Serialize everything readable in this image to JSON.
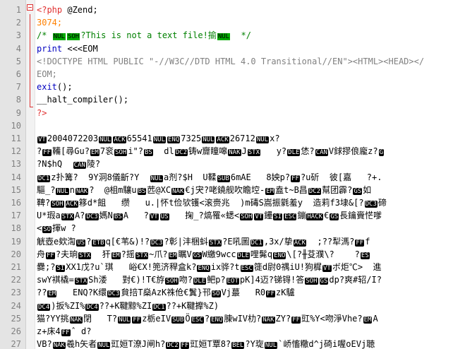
{
  "lines": [
    {
      "n": "1",
      "segs": [
        {
          "t": "<?php",
          "c": "php"
        },
        {
          "t": " @Zend;",
          "c": ""
        }
      ]
    },
    {
      "n": "2",
      "segs": [
        {
          "t": "3074;",
          "c": "num"
        }
      ]
    },
    {
      "n": "3",
      "segs": [
        {
          "t": "/* ",
          "c": "cmt"
        },
        {
          "t": "NUL",
          "c": "cg"
        },
        {
          "t": "SOH",
          "c": "cg"
        },
        {
          "t": "?This is not a text file!揄",
          "c": "cmt"
        },
        {
          "t": "NUL",
          "c": "cg"
        },
        {
          "t": "  */",
          "c": "cmt"
        }
      ]
    },
    {
      "n": "4",
      "segs": [
        {
          "t": "print",
          "c": "kw"
        },
        {
          "t": " <<<EOM",
          "c": ""
        }
      ]
    },
    {
      "n": "5",
      "segs": [
        {
          "t": "<!DOCTYPE HTML PUBLIC \"-//W3C//DTD HTML 4.0 Transitional//EN\"><HTML><HEAD></",
          "c": "hd"
        }
      ]
    },
    {
      "n": "6",
      "segs": [
        {
          "t": "EOM;",
          "c": "hd"
        }
      ]
    },
    {
      "n": "7",
      "segs": [
        {
          "t": "exit",
          "c": "kw"
        },
        {
          "t": "();",
          "c": ""
        }
      ]
    },
    {
      "n": "8",
      "segs": [
        {
          "t": "__halt_compiler",
          "c": ""
        },
        {
          "t": "();",
          "c": ""
        }
      ]
    },
    {
      "n": "9",
      "segs": [
        {
          "t": "?>",
          "c": "php"
        }
      ]
    },
    {
      "n": "10",
      "segs": []
    },
    {
      "n": "11",
      "segs": [
        {
          "t": "VT",
          "c": "cc"
        },
        {
          "t": "2004072203",
          "c": ""
        },
        {
          "t": "NUL",
          "c": "cc"
        },
        {
          "t": "ACK",
          "c": "cc"
        },
        {
          "t": "65541",
          "c": ""
        },
        {
          "t": "NUL",
          "c": "cc"
        },
        {
          "t": "ENQ",
          "c": "cc"
        },
        {
          "t": "7325",
          "c": ""
        },
        {
          "t": "NUL",
          "c": "cc"
        },
        {
          "t": "ACK",
          "c": "cc"
        },
        {
          "t": "26712",
          "c": ""
        },
        {
          "t": "NUL",
          "c": "cc"
        },
        {
          "t": "x?",
          "c": ""
        }
      ]
    },
    {
      "n": "12",
      "segs": [
        {
          "t": "?",
          "c": ""
        },
        {
          "t": "FF",
          "c": "cc"
        },
        {
          "t": "鞴[尋Gu?",
          "c": ""
        },
        {
          "t": "EM",
          "c": "cc"
        },
        {
          "t": "7衮",
          "c": ""
        },
        {
          "t": "SOH",
          "c": "cc"
        },
        {
          "t": "i\"?",
          "c": ""
        },
        {
          "t": "BS",
          "c": "cc"
        },
        {
          "t": "  dl",
          "c": ""
        },
        {
          "t": "DC2",
          "c": "cc"
        },
        {
          "t": "铸w齎瞳嗥",
          "c": ""
        },
        {
          "t": "NAK",
          "c": "cc"
        },
        {
          "t": "J",
          "c": ""
        },
        {
          "t": "STX",
          "c": "cc"
        },
        {
          "t": "   y?",
          "c": ""
        },
        {
          "t": "DLE",
          "c": "cc"
        },
        {
          "t": "恷?",
          "c": ""
        },
        {
          "t": "CAN",
          "c": "cc"
        },
        {
          "t": "V銶摎俍龐z?",
          "c": ""
        },
        {
          "t": "G",
          "c": "cc"
        }
      ]
    },
    {
      "n": "13",
      "segs": [
        {
          "t": "?N$hQ  ",
          "c": ""
        },
        {
          "t": "CAN",
          "c": "cc"
        },
        {
          "t": "陵?",
          "c": ""
        }
      ]
    },
    {
      "n": "14",
      "segs": [
        {
          "t": "DC1",
          "c": "cc"
        },
        {
          "t": "z扑篝?  9Y洞8儀齗?Y  ",
          "c": ""
        },
        {
          "t": "NUL",
          "c": "cc"
        },
        {
          "t": "a剂?$H  U鞣",
          "c": ""
        },
        {
          "t": "SUB",
          "c": "cc"
        },
        {
          "t": "6mAE   8姎p?",
          "c": ""
        },
        {
          "t": "FF",
          "c": "cc"
        },
        {
          "t": "?u斫  彼[嘉   ?+.",
          "c": ""
        }
      ]
    },
    {
      "n": "15",
      "segs": [
        {
          "t": "驅_?",
          "c": ""
        },
        {
          "t": "NUL",
          "c": "cc"
        },
        {
          "t": "n",
          "c": ""
        },
        {
          "t": "NAK",
          "c": "cc"
        },
        {
          "t": "?  @柤m驤u",
          "c": ""
        },
        {
          "t": "BS",
          "c": "cc"
        },
        {
          "t": "苉@XC",
          "c": ""
        },
        {
          "t": "NAK",
          "c": "cc"
        },
        {
          "t": "€j宊?咾鐃舰吹瞻埪-",
          "c": ""
        },
        {
          "t": "EM",
          "c": "cc"
        },
        {
          "t": "盍t~B昌",
          "c": ""
        },
        {
          "t": "DC2",
          "c": "cc"
        },
        {
          "t": "幫团霹?",
          "c": ""
        },
        {
          "t": "GS",
          "c": "cc"
        },
        {
          "t": "如",
          "c": ""
        }
      ]
    },
    {
      "n": "16",
      "segs": [
        {
          "t": "鞞?",
          "c": ""
        },
        {
          "t": "SOH",
          "c": "cc"
        },
        {
          "t": "",
          "c": ""
        },
        {
          "t": "ACK",
          "c": "cc"
        },
        {
          "t": "簃d*飷   缵   u.|怀t俭欤镬<滚赍兆  )m碡S嵩振氋羞y  造莉f3埭&[?",
          "c": ""
        },
        {
          "t": "DC3",
          "c": "cc"
        },
        {
          "t": "碲",
          "c": ""
        }
      ]
    },
    {
      "n": "17",
      "segs": [
        {
          "t": "U*瑕a",
          "c": ""
        },
        {
          "t": "STX",
          "c": "cc"
        },
        {
          "t": "A?",
          "c": ""
        },
        {
          "t": "DC3",
          "c": "cc"
        },
        {
          "t": "媽N",
          "c": ""
        },
        {
          "t": "BS",
          "c": "cc"
        },
        {
          "t": "A   ?",
          "c": ""
        },
        {
          "t": "VT",
          "c": "cc"
        },
        {
          "t": "",
          "c": ""
        },
        {
          "t": "US",
          "c": "cc"
        },
        {
          "t": "   掬_?熇罹«蟋<",
          "c": ""
        },
        {
          "t": "SOH",
          "c": "cc"
        },
        {
          "t": "",
          "c": ""
        },
        {
          "t": "VT",
          "c": "cc"
        },
        {
          "t": "鑸",
          "c": ""
        },
        {
          "t": "SI",
          "c": "cc"
        },
        {
          "t": "",
          "c": ""
        },
        {
          "t": "ESC",
          "c": "cc"
        },
        {
          "t": "鏰",
          "c": ""
        },
        {
          "t": "HACK",
          "c": "cc"
        },
        {
          "t": "€",
          "c": ""
        },
        {
          "t": "GS",
          "c": "cc"
        },
        {
          "t": "長鑰賫恾嗲",
          "c": ""
        }
      ]
    },
    {
      "n": "18",
      "segs": [
        {
          "t": "<",
          "c": ""
        },
        {
          "t": "SO",
          "c": "cc"
        },
        {
          "t": "揮w ?",
          "c": ""
        }
      ]
    },
    {
      "n": "19",
      "segs": [
        {
          "t": "觥壺e欸渹",
          "c": ""
        },
        {
          "t": "US",
          "c": "cc"
        },
        {
          "t": "?",
          "c": ""
        },
        {
          "t": "ETB",
          "c": "cc"
        },
        {
          "t": "q[€苇&)!?",
          "c": ""
        },
        {
          "t": "DC3",
          "c": "cc"
        },
        {
          "t": "?彰|沣梱蚪",
          "c": ""
        },
        {
          "t": "STX",
          "c": "cc"
        },
        {
          "t": "?E吼圖",
          "c": ""
        },
        {
          "t": "DC1",
          "c": "cc"
        },
        {
          "t": ",3x/挚",
          "c": ""
        },
        {
          "t": "ACK",
          "c": "cc"
        },
        {
          "t": "  ;??犁溤?",
          "c": ""
        },
        {
          "t": "FF",
          "c": "cc"
        },
        {
          "t": "f",
          "c": ""
        }
      ]
    },
    {
      "n": "20",
      "segs": [
        {
          "t": "舟",
          "c": ""
        },
        {
          "t": "FF",
          "c": "cc"
        },
        {
          "t": "?夫珦",
          "c": ""
        },
        {
          "t": "STX",
          "c": "cc"
        },
        {
          "t": "  犴",
          "c": ""
        },
        {
          "t": "EM",
          "c": "cc"
        },
        {
          "t": "?摇",
          "c": ""
        },
        {
          "t": "STX",
          "c": "cc"
        },
        {
          "t": "~爪?",
          "c": ""
        },
        {
          "t": "EM",
          "c": "cc"
        },
        {
          "t": "瞩V",
          "c": ""
        },
        {
          "t": "GS",
          "c": "cc"
        },
        {
          "t": "W繳9wcc",
          "c": ""
        },
        {
          "t": "DLE",
          "c": "cc"
        },
        {
          "t": "哩髴q",
          "c": ""
        },
        {
          "t": "ENO",
          "c": "cc"
        },
        {
          "t": "\\[?╫芟濮\\?    ?",
          "c": ""
        },
        {
          "t": "ES",
          "c": "cc"
        }
      ]
    },
    {
      "n": "21",
      "segs": [
        {
          "t": "爨;?",
          "c": ""
        },
        {
          "t": "SI",
          "c": "cc"
        },
        {
          "t": "XX1戊?u`琪   峪€X!篼济稈盒k?",
          "c": ""
        },
        {
          "t": "ENQ",
          "c": "cc"
        },
        {
          "t": "ix骅?t",
          "c": ""
        },
        {
          "t": "ESC",
          "c": "cc"
        },
        {
          "t": "簁d尉0禑iU!狗樨",
          "c": ""
        },
        {
          "t": "VT",
          "c": "cc"
        },
        {
          "t": "ボ炬℃>  進",
          "c": ""
        }
      ]
    },
    {
      "n": "22",
      "segs": [
        {
          "t": "swY褀橇=",
          "c": ""
        },
        {
          "t": "STX",
          "c": "cc"
        },
        {
          "t": "Sh涹   對€)!T€斿",
          "c": ""
        },
        {
          "t": "SOH",
          "c": "cc"
        },
        {
          "t": "吻?",
          "c": ""
        },
        {
          "t": "DLE",
          "c": "cc"
        },
        {
          "t": "鲃p?",
          "c": ""
        },
        {
          "t": "EOT",
          "c": "cc"
        },
        {
          "t": "pK]4迈?锑锝!答",
          "c": ""
        },
        {
          "t": "SOH",
          "c": "cc"
        },
        {
          "t": "",
          "c": ""
        },
        {
          "t": "GS",
          "c": "cc"
        },
        {
          "t": "dp?爽#轺/I?",
          "c": ""
        }
      ]
    },
    {
      "n": "23",
      "segs": [
        {
          "t": "??",
          "c": ""
        },
        {
          "t": "EM",
          "c": "cc"
        },
        {
          "t": "   ENQ?K缳",
          "c": ""
        },
        {
          "t": "DC3",
          "c": "cc"
        },
        {
          "t": "貟掊T燊AzK祩伧€鬒}邗",
          "c": ""
        },
        {
          "t": "SO",
          "c": "cc"
        },
        {
          "t": "Vj蕞   R0",
          "c": ""
        },
        {
          "t": "FF",
          "c": "cc"
        },
        {
          "t": "zK驢",
          "c": ""
        }
      ]
    },
    {
      "n": "24",
      "segs": [
        {
          "t": "DC4",
          "c": "cc"
        },
        {
          "t": ")扳%ZI%",
          "c": ""
        },
        {
          "t": "DC4",
          "c": "cc"
        },
        {
          "t": "??+K鞬黥%ZI",
          "c": ""
        },
        {
          "t": "DC1",
          "c": "cc"
        },
        {
          "t": "??+K鞬擵%Z)",
          "c": ""
        }
      ]
    },
    {
      "n": "25",
      "segs": [
        {
          "t": "猫?YY挑",
          "c": ""
        },
        {
          "t": "NAK",
          "c": "cc"
        },
        {
          "t": "閉   T?",
          "c": ""
        },
        {
          "t": "NUL",
          "c": "cc"
        },
        {
          "t": "",
          "c": ""
        },
        {
          "t": "FF",
          "c": "cc"
        },
        {
          "t": "z栃eIV",
          "c": ""
        },
        {
          "t": "SUB",
          "c": "cc"
        },
        {
          "t": "Ö",
          "c": ""
        },
        {
          "t": "ESC",
          "c": "cc"
        },
        {
          "t": "?",
          "c": ""
        },
        {
          "t": "ENQ",
          "c": "cc"
        },
        {
          "t": "腖wIV朸?",
          "c": ""
        },
        {
          "t": "NAK",
          "c": "cc"
        },
        {
          "t": "ZY?",
          "c": ""
        },
        {
          "t": "FF",
          "c": "cc"
        },
        {
          "t": "豇%Y<吻淨Vhe?",
          "c": ""
        },
        {
          "t": "EM",
          "c": "cc"
        },
        {
          "t": "A",
          "c": ""
        }
      ]
    },
    {
      "n": "26",
      "segs": [
        {
          "t": "z+床4",
          "c": ""
        },
        {
          "t": "FF",
          "c": "cc"
        },
        {
          "t": "ˆ d?",
          "c": ""
        }
      ]
    },
    {
      "n": "27",
      "segs": [
        {
          "t": "VB?",
          "c": ""
        },
        {
          "t": "NAK",
          "c": "cc"
        },
        {
          "t": "羲h矢者",
          "c": ""
        },
        {
          "t": "NUL",
          "c": "cc"
        },
        {
          "t": "豇姮T潦J闸h?",
          "c": ""
        },
        {
          "t": "DC2",
          "c": "cc"
        },
        {
          "t": "",
          "c": ""
        },
        {
          "t": "FF",
          "c": "cc"
        },
        {
          "t": "豇姮T覃8?",
          "c": ""
        },
        {
          "t": "BEL",
          "c": "cc"
        },
        {
          "t": "?Y琁",
          "c": ""
        },
        {
          "t": "NUL",
          "c": "cc"
        },
        {
          "t": "`峤慉糤d^j碕i喔oEVj聴",
          "c": ""
        }
      ]
    }
  ]
}
